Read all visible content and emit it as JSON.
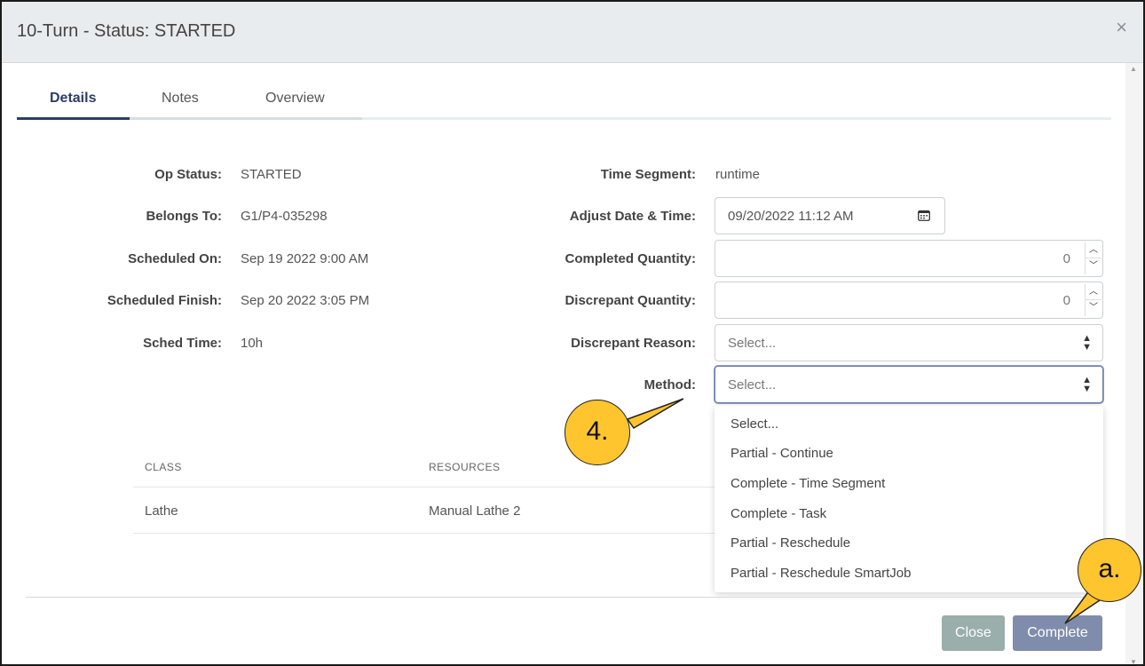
{
  "modal": {
    "title": "10-Turn - Status: STARTED",
    "close_symbol": "×"
  },
  "tabs": [
    {
      "label": "Details",
      "active": true
    },
    {
      "label": "Notes",
      "active": false
    },
    {
      "label": "Overview",
      "active": false
    }
  ],
  "details": {
    "op_status_label": "Op Status:",
    "op_status_value": "STARTED",
    "belongs_to_label": "Belongs To:",
    "belongs_to_value": "G1/P4-035298",
    "scheduled_on_label": "Scheduled On:",
    "scheduled_on_value": "Sep 19 2022 9:00 AM",
    "scheduled_finish_label": "Scheduled Finish:",
    "scheduled_finish_value": "Sep 20 2022 3:05 PM",
    "sched_time_label": "Sched Time:",
    "sched_time_value": "10h"
  },
  "form": {
    "time_segment_label": "Time Segment:",
    "time_segment_value": "runtime",
    "adjust_date_label": "Adjust Date & Time:",
    "adjust_date_value": "09/20/2022 11:12 AM",
    "completed_qty_label": "Completed Quantity:",
    "completed_qty_value": "0",
    "discrepant_qty_label": "Discrepant Quantity:",
    "discrepant_qty_value": "0",
    "discrepant_reason_label": "Discrepant Reason:",
    "discrepant_reason_value": "Select...",
    "method_label": "Method:",
    "method_value": "Select..."
  },
  "method_options": [
    "Select...",
    "Partial - Continue",
    "Complete - Time Segment",
    "Complete - Task",
    "Partial - Reschedule",
    "Partial - Reschedule SmartJob"
  ],
  "table": {
    "headers": [
      "CLASS",
      "RESOURCES"
    ],
    "rows": [
      [
        "Lathe",
        "Manual Lathe 2"
      ]
    ]
  },
  "footer": {
    "close_label": "Close",
    "complete_label": "Complete"
  },
  "callouts": {
    "step4": "4.",
    "step_a": "a."
  },
  "colors": {
    "accent": "#2c3e63",
    "callout": "#fec52e",
    "close_button": "#9aaeab",
    "complete_button": "#7f8cab"
  }
}
